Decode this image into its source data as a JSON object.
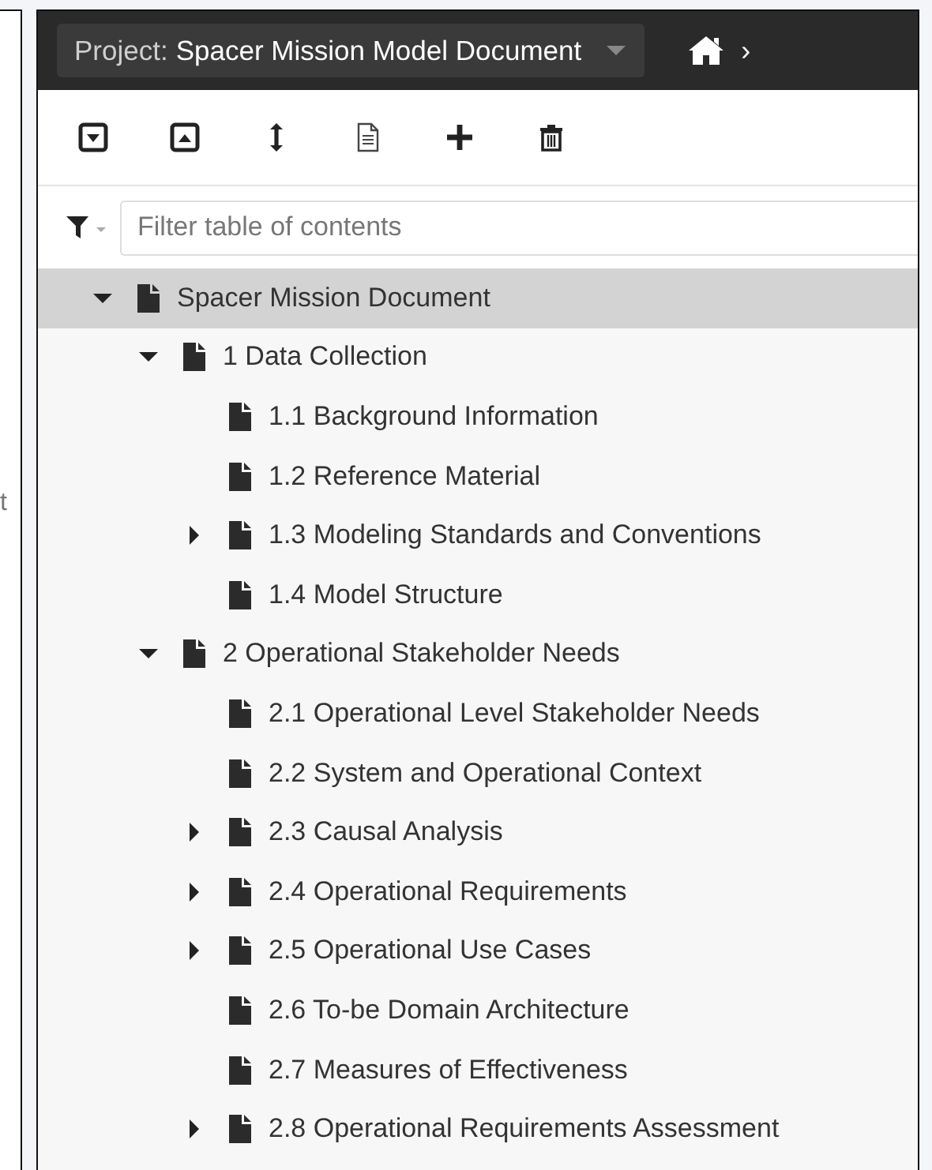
{
  "left_panel": {
    "text_fragment": "t"
  },
  "header": {
    "project_label": "Project:",
    "project_name": "Spacer Mission Model Document",
    "breadcrumb_separator": "›"
  },
  "toolbar": {
    "buttons": [
      {
        "kind": "expand"
      },
      {
        "kind": "collapse"
      },
      {
        "kind": "resize"
      },
      {
        "kind": "document"
      },
      {
        "kind": "add"
      },
      {
        "kind": "delete"
      }
    ]
  },
  "filter": {
    "placeholder": "Filter table of contents"
  },
  "tree": [
    {
      "label": "Spacer Mission Document",
      "kind": "branch",
      "expanded": true,
      "selected": true,
      "children": [
        {
          "label": "1 Data Collection",
          "kind": "branch",
          "expanded": true,
          "selected": false,
          "children": [
            {
              "label": "1.1 Background Information",
              "kind": "leaf",
              "selected": false
            },
            {
              "label": "1.2 Reference Material",
              "kind": "leaf",
              "selected": false
            },
            {
              "label": "1.3 Modeling Standards and Conventions",
              "kind": "branch",
              "expanded": false,
              "selected": false
            },
            {
              "label": "1.4 Model Structure",
              "kind": "leaf",
              "selected": false
            }
          ]
        },
        {
          "label": "2 Operational Stakeholder Needs",
          "kind": "branch",
          "expanded": true,
          "selected": false,
          "children": [
            {
              "label": "2.1 Operational Level Stakeholder Needs",
              "kind": "leaf",
              "selected": false
            },
            {
              "label": "2.2 System and Operational Context",
              "kind": "leaf",
              "selected": false
            },
            {
              "label": "2.3 Causal Analysis",
              "kind": "branch",
              "expanded": false,
              "selected": false
            },
            {
              "label": "2.4 Operational Requirements",
              "kind": "branch",
              "expanded": false,
              "selected": false
            },
            {
              "label": "2.5 Operational Use Cases",
              "kind": "branch",
              "expanded": false,
              "selected": false
            },
            {
              "label": "2.6 To-be Domain Architecture",
              "kind": "leaf",
              "selected": false
            },
            {
              "label": "2.7 Measures of Effectiveness",
              "kind": "leaf",
              "selected": false
            },
            {
              "label": "2.8 Operational Requirements Assessment",
              "kind": "branch",
              "expanded": false,
              "selected": false
            }
          ]
        }
      ]
    }
  ]
}
